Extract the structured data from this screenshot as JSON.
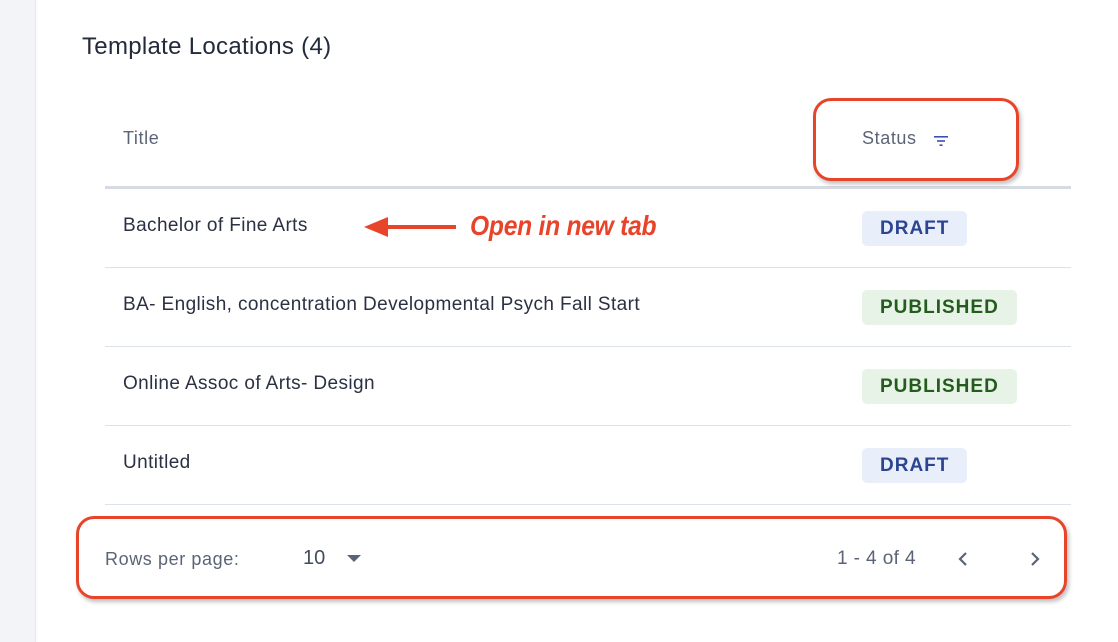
{
  "page": {
    "title": "Template Locations (4)"
  },
  "table": {
    "columns": [
      {
        "label": "Title"
      },
      {
        "label": "Status",
        "icon": "filter-icon"
      }
    ],
    "rows": [
      {
        "title": "Bachelor of Fine Arts",
        "status": "DRAFT"
      },
      {
        "title": "BA- English, concentration Developmental Psych Fall Start",
        "status": "PUBLISHED"
      },
      {
        "title": "Online Assoc of Arts- Design",
        "status": "PUBLISHED"
      },
      {
        "title": "Untitled",
        "status": "DRAFT"
      }
    ]
  },
  "pagination": {
    "rows_per_page_label": "Rows per page:",
    "rows_per_page_value": "10",
    "range": "1 - 4 of 4",
    "prev_icon": "chevron-left-icon",
    "next_icon": "chevron-right-icon"
  },
  "annotation": {
    "callout_text": "Open in new tab",
    "color": "#e8442a"
  },
  "colors": {
    "draft_bg": "#e8eefa",
    "draft_fg": "#2c4592",
    "published_bg": "#e7f3e7",
    "published_fg": "#245c1e",
    "filter_icon": "#3d4fb0"
  }
}
